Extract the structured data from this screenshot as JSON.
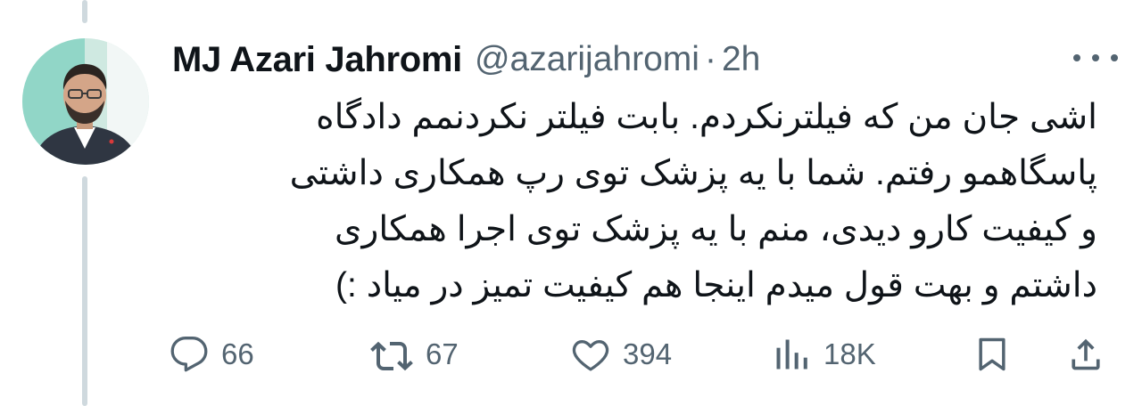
{
  "tweet": {
    "author": {
      "display_name": "MJ Azari Jahromi",
      "handle": "@azarijahromi",
      "separator": "·",
      "time": "2h"
    },
    "body_lines": [
      "اشی جان من که فیلترنکردم. بابت فیلتر نکردنمم دادگاه",
      "پاسگاهمو رفتم. شما با یه پزشک توی رپ همکاری داشتی",
      "و کیفیت کارو دیدی، منم با یه پزشک توی اجرا همکاری",
      "داشتم و بهت قول میدم اینجا هم کیفیت تمیز در میاد :)"
    ],
    "actions": {
      "replies": "66",
      "retweets": "67",
      "likes": "394",
      "views": "18K"
    },
    "icons": {
      "reply": "reply-icon",
      "retweet": "retweet-icon",
      "like": "heart-icon",
      "views": "views-icon",
      "bookmark": "bookmark-icon",
      "share": "share-icon",
      "more": "more-icon"
    },
    "colors": {
      "text": "#0f1419",
      "secondary": "#536471",
      "thread_line": "#cfd9de"
    }
  }
}
